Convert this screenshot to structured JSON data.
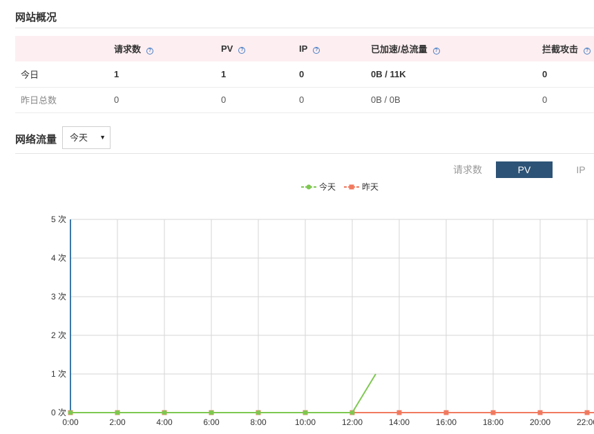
{
  "overview": {
    "title": "网站概况",
    "columns": [
      {
        "label": "请求数",
        "help": "?"
      },
      {
        "label": "PV",
        "help": "?"
      },
      {
        "label": "IP",
        "help": "?"
      },
      {
        "label": "已加速/总流量",
        "help": "?"
      },
      {
        "label": "拦截攻击",
        "help": "?"
      }
    ],
    "rows": [
      {
        "label": "今日",
        "values": [
          "1",
          "1",
          "0",
          "0B / 11K",
          "0"
        ]
      },
      {
        "label": "昨日总数",
        "values": [
          "0",
          "0",
          "0",
          "0B / 0B",
          "0"
        ]
      }
    ]
  },
  "traffic": {
    "title": "网络流量",
    "range_selected": "今天",
    "caret": "▼",
    "tabs": [
      "请求数",
      "PV",
      "IP"
    ],
    "active_tab": "PV"
  },
  "colors": {
    "today": "#7ec850",
    "yesterday": "#f07a5f",
    "active_tab": "#2d5376",
    "y_axis": "#3b77a8"
  },
  "chart_data": {
    "type": "line",
    "legend": [
      "今天",
      "昨天"
    ],
    "legend_placement": "top-center",
    "y_tick_labels": [
      "0 次",
      "1 次",
      "2 次",
      "3 次",
      "4 次",
      "5 次"
    ],
    "ylim": [
      0,
      5
    ],
    "x_tick_labels": [
      "0:00",
      "2:00",
      "4:00",
      "6:00",
      "8:00",
      "10:00",
      "12:00",
      "14:00",
      "16:00",
      "18:00",
      "20:00",
      "22:00"
    ],
    "grid": true,
    "series": [
      {
        "name": "今天",
        "x": [
          0,
          2,
          4,
          6,
          8,
          10,
          12,
          13
        ],
        "y": [
          0,
          0,
          0,
          0,
          0,
          0,
          0,
          1
        ]
      },
      {
        "name": "昨天",
        "x": [
          0,
          2,
          4,
          6,
          8,
          10,
          12,
          14,
          16,
          18,
          20,
          22
        ],
        "y": [
          0,
          0,
          0,
          0,
          0,
          0,
          0,
          0,
          0,
          0,
          0,
          0
        ]
      }
    ]
  }
}
